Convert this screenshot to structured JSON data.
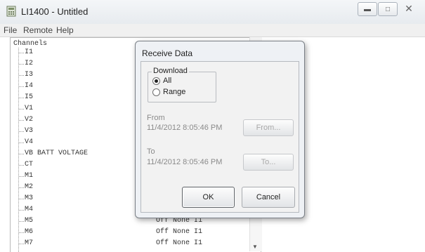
{
  "window": {
    "title": "LI1400 - Untitled",
    "min_icon": "minimize-icon",
    "max_icon": "maximize-icon",
    "close_glyph": "✕"
  },
  "menu": [
    {
      "label": "File"
    },
    {
      "label": "Remote"
    },
    {
      "label": "Help"
    }
  ],
  "tree": {
    "root": "Channels",
    "items": [
      {
        "label": "I1",
        "status": ""
      },
      {
        "label": "I2",
        "status": ""
      },
      {
        "label": "I3",
        "status": ""
      },
      {
        "label": "I4",
        "status": ""
      },
      {
        "label": "I5",
        "status": ""
      },
      {
        "label": "V1",
        "status": ""
      },
      {
        "label": "V2",
        "status": ""
      },
      {
        "label": "V3",
        "status": ""
      },
      {
        "label": "V4",
        "status": ""
      },
      {
        "label": "VB BATT VOLTAGE",
        "status": ""
      },
      {
        "label": "CT",
        "status": ""
      },
      {
        "label": "M1",
        "status": ""
      },
      {
        "label": "M2",
        "status": ""
      },
      {
        "label": "M3",
        "status": ""
      },
      {
        "label": "M4",
        "status": ""
      },
      {
        "label": "M5",
        "status": "Off None I1"
      },
      {
        "label": "M6",
        "status": "Off None I1"
      },
      {
        "label": "M7",
        "status": "Off None I1"
      }
    ]
  },
  "dialog": {
    "title": "Receive Data",
    "download": {
      "legend": "Download",
      "options": [
        {
          "label": "All",
          "selected": true
        },
        {
          "label": "Range",
          "selected": false
        }
      ]
    },
    "from": {
      "label": "From",
      "value": "11/4/2012 8:05:46 PM",
      "button": "From..."
    },
    "to": {
      "label": "To",
      "value": "11/4/2012 8:05:46 PM",
      "button": "To..."
    },
    "ok": "OK",
    "cancel": "Cancel"
  }
}
